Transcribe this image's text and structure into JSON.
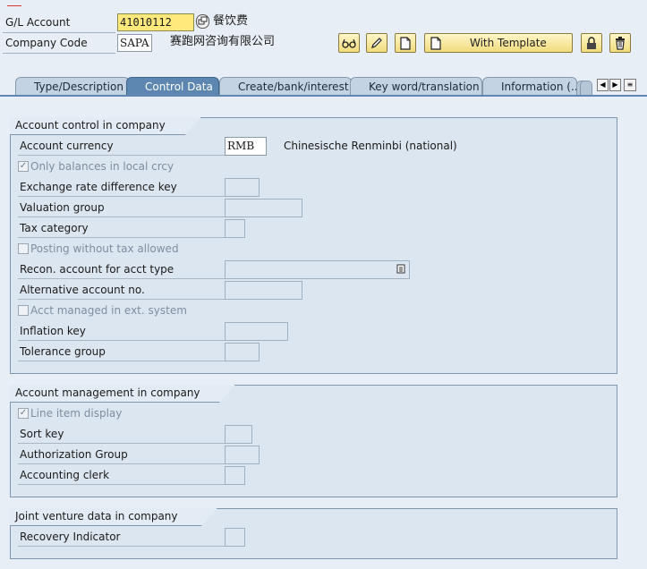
{
  "header": {
    "gl_account_label": "G/L Account",
    "gl_account_value": "41010112",
    "gl_account_name": "餐饮费",
    "company_code_label": "Company Code",
    "company_code_value": "SAPA",
    "company_name": "赛跑网咨询有限公司"
  },
  "toolbar": {
    "with_template_label": "With Template",
    "icons": [
      "glasses-icon",
      "pencil-icon",
      "document-icon",
      "with-template-document-icon",
      "lock-icon",
      "trash-icon"
    ]
  },
  "tabs": [
    {
      "label": "Type/Description",
      "active": false
    },
    {
      "label": "Control Data",
      "active": true
    },
    {
      "label": "Create/bank/interest",
      "active": false
    },
    {
      "label": "Key word/translation",
      "active": false
    },
    {
      "label": "Information (...",
      "active": false
    }
  ],
  "groups": {
    "account_control": {
      "title": "Account control in company code",
      "account_currency_label": "Account currency",
      "account_currency_value": "RMB",
      "account_currency_text": "Chinesische Renminbi (national)",
      "only_balances_label": "Only balances in local crcy",
      "only_balances_checked": true,
      "exchange_rate_label": "Exchange rate difference key",
      "valuation_group_label": "Valuation group",
      "tax_category_label": "Tax category",
      "posting_without_tax_label": "Posting without tax allowed",
      "posting_without_tax_checked": false,
      "recon_account_label": "Recon. account for acct type",
      "alt_account_label": "Alternative account no.",
      "acct_managed_label": "Acct managed in ext. system",
      "acct_managed_checked": false,
      "inflation_key_label": "Inflation key",
      "tolerance_group_label": "Tolerance group"
    },
    "account_management": {
      "title": "Account management in company code",
      "line_item_label": "Line item display",
      "line_item_checked": true,
      "sort_key_label": "Sort key",
      "authorization_group_label": "Authorization Group",
      "accounting_clerk_label": "Accounting clerk"
    },
    "joint_venture": {
      "title": "Joint venture data in company code",
      "recovery_indicator_label": "Recovery Indicator"
    }
  },
  "colors": {
    "active_tab": "#5d86b0",
    "required_field": "#ffe97d",
    "button_bg": "#f0dc7c"
  }
}
